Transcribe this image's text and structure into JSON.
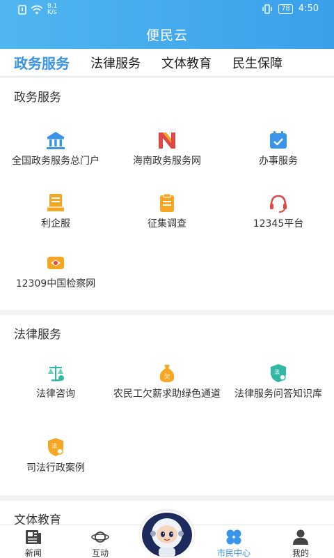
{
  "status_bar": {
    "speed_value": "8.1",
    "speed_unit": "K/s",
    "battery": "78",
    "time": "4:50"
  },
  "header": {
    "title": "便民云"
  },
  "tabs": [
    {
      "label": "政务服务",
      "active": true
    },
    {
      "label": "法律服务",
      "active": false
    },
    {
      "label": "文体教育",
      "active": false
    },
    {
      "label": "民生保障",
      "active": false
    }
  ],
  "sections": [
    {
      "title": "政务服务",
      "items": [
        {
          "label": "全国政务服务总门户",
          "icon": "government-building-icon"
        },
        {
          "label": "海南政务服务网",
          "icon": "hainan-n-logo-icon"
        },
        {
          "label": "办事服务",
          "icon": "calendar-check-icon"
        },
        {
          "label": "利企服",
          "icon": "document-stack-icon"
        },
        {
          "label": "征集调查",
          "icon": "clipboard-icon"
        },
        {
          "label": "12345平台",
          "icon": "headset-icon"
        },
        {
          "label": "12309中国检察网",
          "icon": "procuratorate-emblem-icon"
        }
      ]
    },
    {
      "title": "法律服务",
      "items": [
        {
          "label": "法律咨询",
          "icon": "scales-icon"
        },
        {
          "label": "农民工欠薪求助绿色通道",
          "icon": "money-bag-icon"
        },
        {
          "label": "法律服务问答知识库",
          "icon": "law-shield-icon"
        },
        {
          "label": "司法行政案例",
          "icon": "law-badge-icon"
        }
      ]
    },
    {
      "title": "文体教育",
      "items": []
    }
  ],
  "bottom_nav": [
    {
      "label": "新闻",
      "icon": "newspaper-icon",
      "active": false
    },
    {
      "label": "互动",
      "icon": "planet-icon",
      "active": false
    },
    {
      "label": "",
      "icon": "astronaut-mascot-icon",
      "active": false
    },
    {
      "label": "市民中心",
      "icon": "four-petal-icon",
      "active": true
    },
    {
      "label": "我的",
      "icon": "user-icon",
      "active": false
    }
  ],
  "colors": {
    "accent": "#3a94e8",
    "header": "#45aaee",
    "orange": "#f5a623",
    "teal": "#2fb8a4",
    "red": "#e04848"
  }
}
